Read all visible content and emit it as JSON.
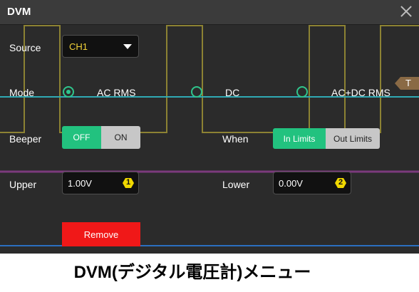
{
  "dialog": {
    "title": "DVM"
  },
  "source": {
    "label": "Source",
    "selected": "CH1"
  },
  "mode": {
    "label": "Mode",
    "options": [
      "AC RMS",
      "DC",
      "AC+DC RMS"
    ],
    "selected": "AC RMS"
  },
  "beeper": {
    "label": "Beeper",
    "off": "OFF",
    "on": "ON",
    "selected": "OFF"
  },
  "when": {
    "label": "When",
    "options": [
      "In Limits",
      "Out Limits"
    ],
    "selected": "In Limits"
  },
  "upper": {
    "label": "Upper",
    "value": "1.00V",
    "knob": "1"
  },
  "lower": {
    "label": "Lower",
    "value": "0.00V",
    "knob": "2"
  },
  "remove_label": "Remove",
  "trigger_marker": "T",
  "caption": "DVM(デジタル電圧計)メニュー",
  "colors": {
    "accent_green": "#22c27f",
    "ch1_yellow": "#b9a93b",
    "ch2_cyan": "#2fa9b3",
    "ch3_purple": "#8b3e8c",
    "remove_red": "#f01818"
  }
}
